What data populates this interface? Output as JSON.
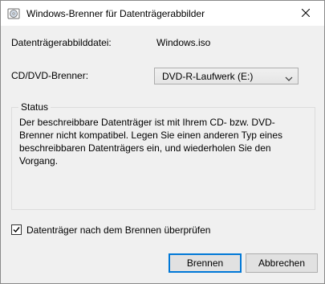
{
  "window": {
    "title": "Windows-Brenner für Datenträgerabbilder"
  },
  "form": {
    "image_file_label": "Datenträgerabbilddatei:",
    "image_file_value": "Windows.iso",
    "burner_label": "CD/DVD-Brenner:",
    "burner_selected": "DVD-R-Laufwerk (E:)"
  },
  "status": {
    "legend": "Status",
    "message": "Der beschreibbare Datenträger ist mit Ihrem CD- bzw. DVD-Brenner nicht kompatibel. Legen Sie einen anderen Typ eines beschreibbaren Datenträgers ein, und wiederholen Sie den Vorgang."
  },
  "options": {
    "verify_label": "Datenträger nach dem Brennen überprüfen",
    "verify_checked": true
  },
  "buttons": {
    "burn_label": "Brennen",
    "cancel_label": "Abbrechen"
  },
  "icons": {
    "app": "disc-burner-icon",
    "close": "close-icon",
    "dropdown": "chevron-down-icon",
    "check": "checkmark-icon"
  },
  "colors": {
    "accent": "#0078d7",
    "dialog_bg": "#f0f0f0"
  }
}
